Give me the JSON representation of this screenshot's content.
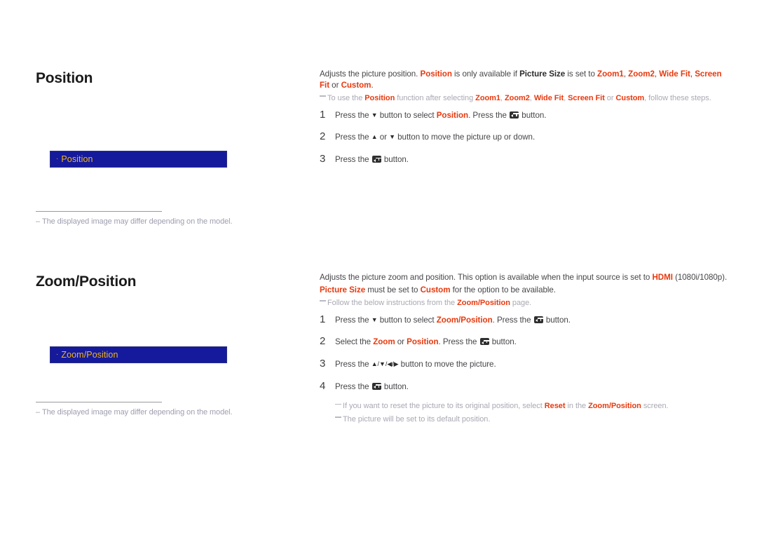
{
  "sections": [
    {
      "heading": "Position",
      "osd": {
        "bullet": "·",
        "label": "Position"
      },
      "footnote": {
        "dash": "–",
        "text": "The displayed image may differ depending on the model."
      },
      "intro": {
        "p1_a": "Adjusts the picture position. ",
        "p1_b": "Position",
        "p1_c": " is only available if ",
        "p1_d": "Picture Size",
        "p1_e": " is set to ",
        "p1_f": "Zoom1",
        "p1_g": ", ",
        "p1_h": "Zoom2",
        "p1_i": ", ",
        "p1_j": "Wide Fit",
        "p1_k": ", ",
        "p1_l": "Screen Fit",
        "p1_m": " or ",
        "p1_n": "Custom",
        "p1_o": "."
      },
      "note": {
        "a": "To use the ",
        "b": "Position",
        "c": " function after selecting ",
        "d": "Zoom1",
        "e": ", ",
        "f": "Zoom2",
        "g": ", ",
        "h": "Wide Fit",
        "i": ", ",
        "j": "Screen Fit",
        "k": " or ",
        "l": "Custom",
        "m": ", follow these steps."
      },
      "steps": [
        {
          "num": "1",
          "t1": "Press the ",
          "arrow1": "▼",
          "t2": " button to select ",
          "hl1": "Position",
          "t3": ". Press the ",
          "key": "enter-key-icon",
          "t4": " button."
        },
        {
          "num": "2",
          "t1": "Press the ",
          "arrow1": "▲",
          "t2": " or ",
          "arrow2": "▼",
          "t3": " button to move the picture up or down."
        },
        {
          "num": "3",
          "t1": "Press the ",
          "key": "enter-key-icon",
          "t2": " button."
        }
      ]
    },
    {
      "heading": "Zoom/Position",
      "osd": {
        "bullet": "·",
        "label": "Zoom/Position"
      },
      "footnote": {
        "dash": "–",
        "text": "The displayed image may differ depending on the model."
      },
      "intro": {
        "p1_a": "Adjusts the picture zoom and position. This option is available when the input source is set to ",
        "p1_b": "HDMI",
        "p1_c": " (1080i/1080p).",
        "p2_a": "Picture Size",
        "p2_b": " must be set to ",
        "p2_c": "Custom",
        "p2_d": " for the option to be available."
      },
      "note": {
        "a": "Follow the below instructions from the ",
        "b": "Zoom/Position",
        "c": " page."
      },
      "steps": [
        {
          "num": "1",
          "t1": "Press the ",
          "arrow1": "▼",
          "t2": " button to select ",
          "hl1": "Zoom/Position",
          "t3": ". Press the ",
          "key": "enter-key-icon",
          "t4": " button."
        },
        {
          "num": "2",
          "t1": "Select the ",
          "hl1": "Zoom",
          "t2": " or ",
          "hl2": "Position",
          "t3": ". Press the ",
          "key": "enter-key-icon",
          "t4": " button."
        },
        {
          "num": "3",
          "t1": "Press the ",
          "arrows": "▲/▼/◀/▶",
          "t2": " button to move the picture."
        },
        {
          "num": "4",
          "t1": "Press the ",
          "key": "enter-key-icon",
          "t2": " button."
        }
      ],
      "subnotes": [
        {
          "a": "If you want to reset the picture to its original position, select ",
          "b": "Reset",
          "c": " in the ",
          "d": "Zoom/Position",
          "e": " screen."
        },
        {
          "a": "The picture will be set to its default position.",
          "b": "",
          "c": "",
          "d": "",
          "e": ""
        }
      ]
    }
  ],
  "colors": {
    "accent_red": "#e8390e",
    "osd_background": "#141a9b",
    "osd_text": "#f3b519",
    "body_text": "#46464a",
    "note_text": "#a9a9b4"
  }
}
